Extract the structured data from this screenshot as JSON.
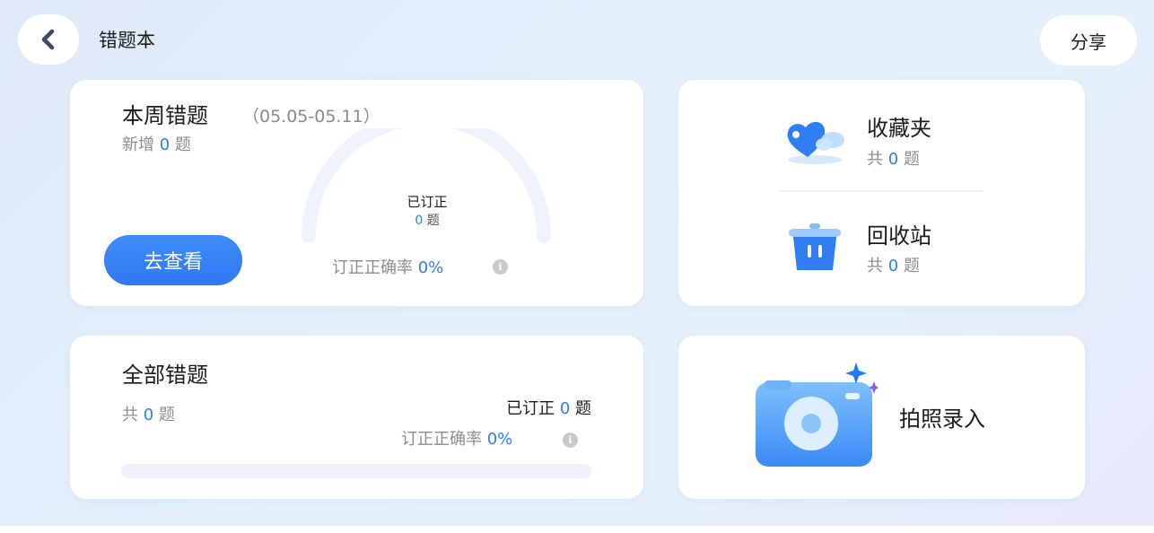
{
  "header": {
    "title": "错题本",
    "share_label": "分享"
  },
  "weekly": {
    "title": "本周错题",
    "date_range": "（05.05-05.11）",
    "added_prefix": "新增",
    "added_count": "0",
    "unit": "题",
    "gauge_label": "已订正",
    "gauge_count": "0",
    "gauge_progress": 0,
    "rate_label": "订正正确率",
    "rate_value": "0%",
    "button_label": "去查看"
  },
  "favorites": {
    "title": "收藏夹",
    "prefix": "共",
    "count": "0",
    "unit": "题"
  },
  "recycle": {
    "title": "回收站",
    "prefix": "共",
    "count": "0",
    "unit": "题"
  },
  "all": {
    "title": "全部错题",
    "prefix": "共",
    "count": "0",
    "unit": "题",
    "corrected_label": "已订正",
    "corrected_count": "0",
    "rate_label": "订正正确率",
    "rate_value": "0%",
    "progress": 0
  },
  "photo": {
    "label": "拍照录入"
  },
  "colors": {
    "accent": "#2e7cf6",
    "title_text": "#1b1b1b",
    "muted_text": "#8c8c8c"
  }
}
